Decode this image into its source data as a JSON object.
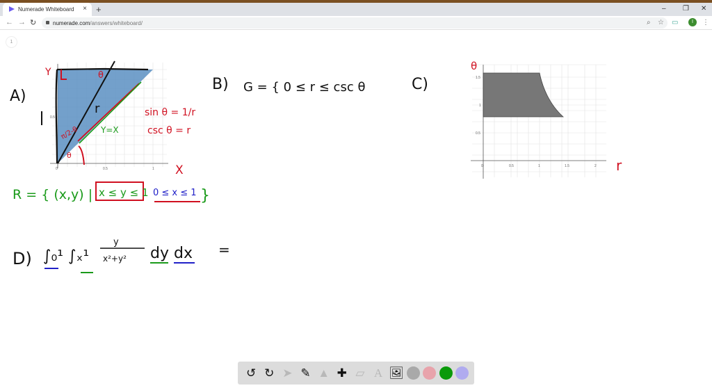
{
  "browser": {
    "tab_title": "Numerade Whiteboard",
    "url_host": "numerade.com",
    "url_path": "/answers/whiteboard/",
    "avatar_letter": "I"
  },
  "whiteboard": {
    "zoom_label": "1",
    "part_a": {
      "label": "A)",
      "y_label": "Y",
      "x_label": "X",
      "side_label": "1",
      "r_label": "r",
      "theta": "θ",
      "line_label": "Y=X",
      "sin_eq": "sin θ = 1/r",
      "csc_eq": "csc θ = r",
      "angle_label": "π/2-θ",
      "region_prefix": "R = { (x,y) |",
      "region_y": "x ≤ y ≤ 1",
      "region_x": "0 ≤ x ≤ 1",
      "region_close": "}",
      "x_ticks": [
        "0",
        "0.5",
        "1"
      ],
      "y_ticks": [
        "0.5"
      ]
    },
    "part_b": {
      "label": "B)",
      "text": "G = { 0 ≤ r ≤ csc θ"
    },
    "part_c": {
      "label": "C)",
      "theta_axis": "θ",
      "r_axis": "r",
      "x_ticks": [
        "0",
        "0.5",
        "1",
        "1.5",
        "2"
      ],
      "y_ticks": [
        "0.5",
        "1",
        "1.5"
      ]
    },
    "part_d": {
      "label": "D)",
      "integral": "∫₀¹ ∫ₓ¹",
      "num": "y",
      "den": "x²+y²",
      "diff": "dy dx",
      "equals": "="
    }
  },
  "toolbar": {
    "colors": {
      "gray": "#a9a9a9",
      "pink": "#e8a3ab",
      "green": "#0a9a0a",
      "lavender": "#b0abef"
    }
  }
}
